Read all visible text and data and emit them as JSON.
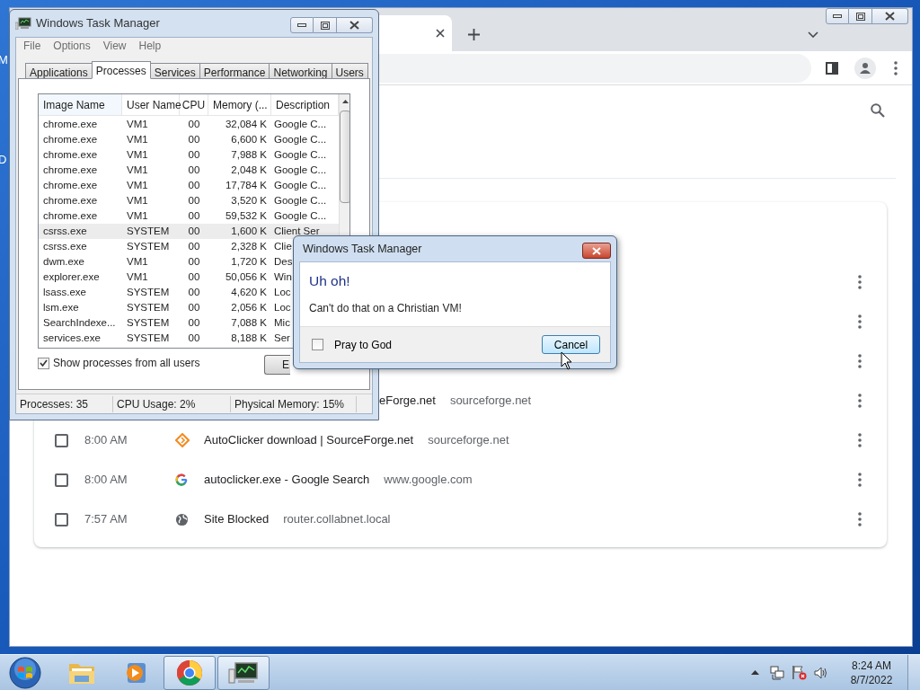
{
  "desktop": {
    "icon_labels": [
      "M",
      "D"
    ]
  },
  "browser": {
    "history_rows": [
      {
        "kind": "covered"
      },
      {
        "kind": "covered"
      },
      {
        "kind": "covered"
      },
      {
        "kind": "partial",
        "title": "eForge.net",
        "site": "sourceforge.net"
      },
      {
        "kind": "full",
        "checked": false,
        "time": "8:00 AM",
        "title": "AutoClicker download | SourceForge.net",
        "site": "sourceforge.net"
      },
      {
        "kind": "full",
        "checked": false,
        "time": "8:00 AM",
        "title": "autoclicker.exe - Google Search",
        "site": "www.google.com"
      },
      {
        "kind": "full",
        "checked": false,
        "time": "7:57 AM",
        "title": "Site Blocked",
        "site": "router.collabnet.local"
      }
    ]
  },
  "task_manager": {
    "title": "Windows Task Manager",
    "menu": [
      "File",
      "Options",
      "View",
      "Help"
    ],
    "tabs": [
      {
        "label": "Applications",
        "selected": false
      },
      {
        "label": "Processes",
        "selected": true
      },
      {
        "label": "Services",
        "selected": false
      },
      {
        "label": "Performance",
        "selected": false
      },
      {
        "label": "Networking",
        "selected": false
      },
      {
        "label": "Users",
        "selected": false
      }
    ],
    "columns": [
      "Image Name",
      "User Name",
      "CPU",
      "Memory (...",
      "Description"
    ],
    "rows": [
      {
        "cells": [
          "chrome.exe",
          "VM1",
          "00",
          "32,084 K",
          "Google C..."
        ],
        "selected": false
      },
      {
        "cells": [
          "chrome.exe",
          "VM1",
          "00",
          "6,600 K",
          "Google C..."
        ],
        "selected": false
      },
      {
        "cells": [
          "chrome.exe",
          "VM1",
          "00",
          "7,988 K",
          "Google C..."
        ],
        "selected": false
      },
      {
        "cells": [
          "chrome.exe",
          "VM1",
          "00",
          "2,048 K",
          "Google C..."
        ],
        "selected": false
      },
      {
        "cells": [
          "chrome.exe",
          "VM1",
          "00",
          "17,784 K",
          "Google C..."
        ],
        "selected": false
      },
      {
        "cells": [
          "chrome.exe",
          "VM1",
          "00",
          "3,520 K",
          "Google C..."
        ],
        "selected": false
      },
      {
        "cells": [
          "chrome.exe",
          "VM1",
          "00",
          "59,532 K",
          "Google C..."
        ],
        "selected": false
      },
      {
        "cells": [
          "csrss.exe",
          "SYSTEM",
          "00",
          "1,600 K",
          "Client Ser"
        ],
        "selected": true
      },
      {
        "cells": [
          "csrss.exe",
          "SYSTEM",
          "00",
          "2,328 K",
          "Clie"
        ],
        "selected": false
      },
      {
        "cells": [
          "dwm.exe",
          "VM1",
          "00",
          "1,720 K",
          "Des"
        ],
        "selected": false
      },
      {
        "cells": [
          "explorer.exe",
          "VM1",
          "00",
          "50,056 K",
          "Win"
        ],
        "selected": false
      },
      {
        "cells": [
          "lsass.exe",
          "SYSTEM",
          "00",
          "4,620 K",
          "Loc"
        ],
        "selected": false
      },
      {
        "cells": [
          "lsm.exe",
          "SYSTEM",
          "00",
          "2,056 K",
          "Loc"
        ],
        "selected": false
      },
      {
        "cells": [
          "SearchIndexe...",
          "SYSTEM",
          "00",
          "7,088 K",
          "Mic"
        ],
        "selected": false
      },
      {
        "cells": [
          "services.exe",
          "SYSTEM",
          "00",
          "8,188 K",
          "Ser"
        ],
        "selected": false
      }
    ],
    "show_all_users": {
      "label": "Show processes from all users",
      "checked": true
    },
    "end_button": "E",
    "status": [
      "Processes: 35",
      "CPU Usage: 2%",
      "Physical Memory: 15%"
    ]
  },
  "dialog": {
    "title": "Windows Task Manager",
    "heading": "Uh oh!",
    "message": "Can't do that on a Christian VM!",
    "checkbox": {
      "label": "Pray to God",
      "checked": false
    },
    "button": {
      "label": "Cancel",
      "focused": true
    }
  },
  "taskbar": {
    "apps": [
      {
        "kind": "folder",
        "active": false
      },
      {
        "kind": "media",
        "active": false
      },
      {
        "kind": "chrome",
        "active": true
      },
      {
        "kind": "taskmgr",
        "active": true
      }
    ],
    "clock": {
      "time": "8:24 AM",
      "date": "8/7/2022"
    }
  }
}
